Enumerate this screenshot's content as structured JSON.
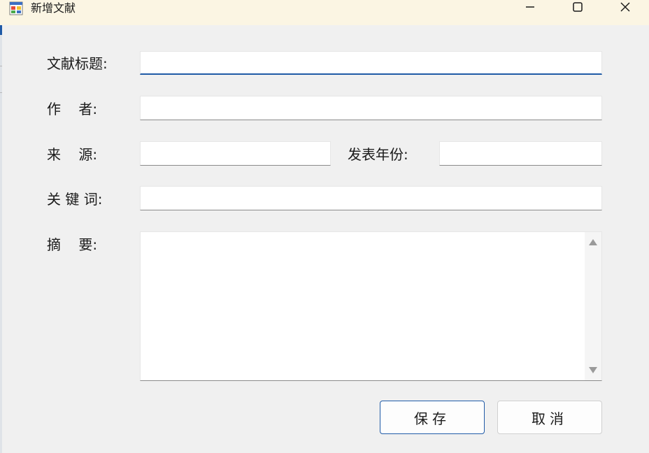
{
  "window": {
    "title": "新增文献",
    "minimize_icon": "minimize-icon",
    "maximize_icon": "maximize-icon",
    "close_icon": "close-icon"
  },
  "form": {
    "title_label": "文献标题:",
    "title_value": "",
    "author_label": "作    者:",
    "author_value": "",
    "source_label": "来    源:",
    "source_value": "",
    "year_label": "发表年份:",
    "year_value": "",
    "keywords_label": "关 键 词:",
    "keywords_value": "",
    "abstract_label": "摘    要:",
    "abstract_value": ""
  },
  "buttons": {
    "save_label": "保存",
    "cancel_label": "取消"
  },
  "colors": {
    "titlebar": "#fbf5e3",
    "background": "#f0f0f0",
    "accent": "#1f5aa6"
  }
}
